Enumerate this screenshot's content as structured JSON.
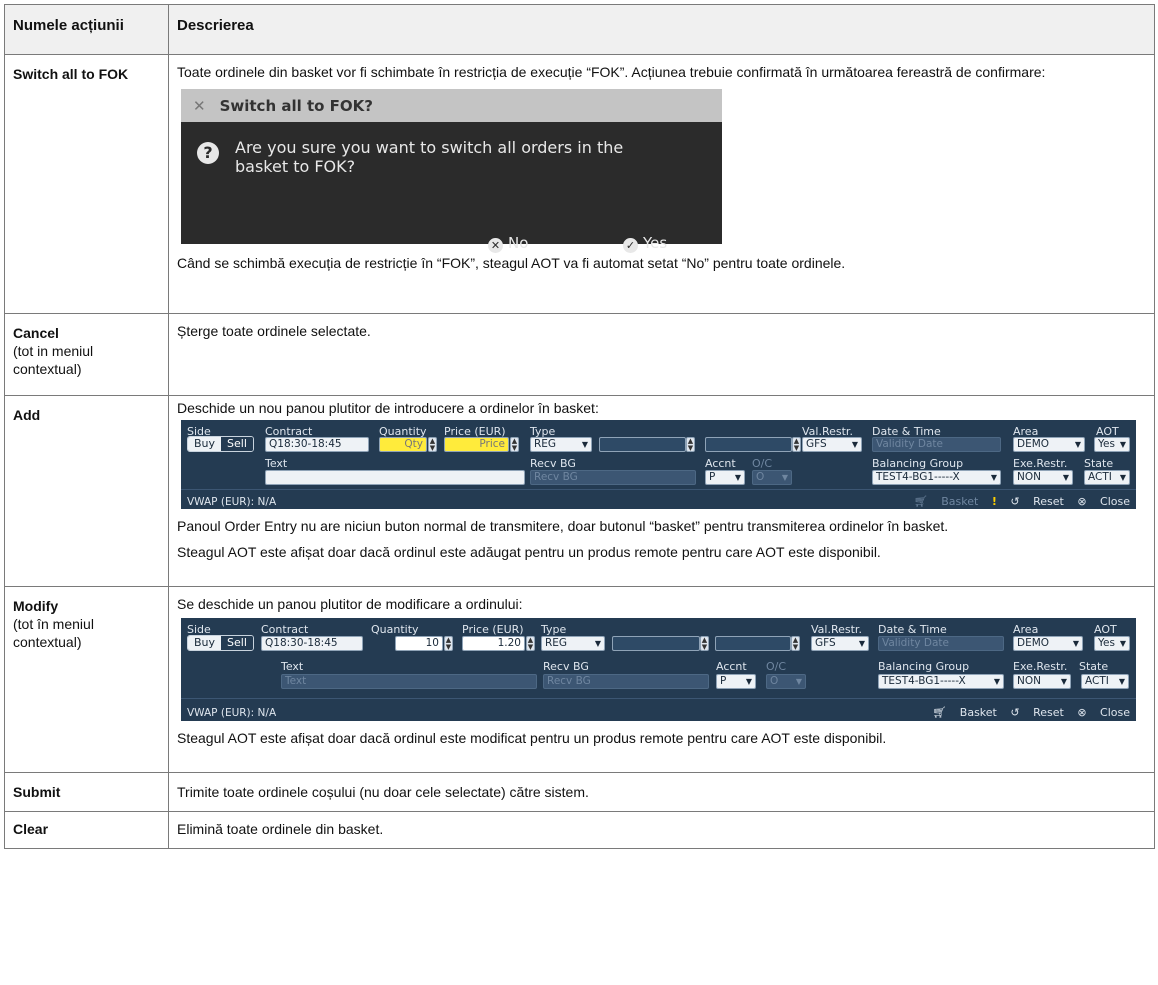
{
  "header": {
    "col1": "Numele acțiunii",
    "col2": "Descrierea"
  },
  "rows": {
    "switch": {
      "name": "Switch all to FOK",
      "desc1": "Toate ordinele din basket vor fi schimbate în restricția de execuție “FOK”. Acțiunea trebuie confirmată în următoarea fereastră de confirmare:",
      "desc2": "Când se schimbă execuția de restricție în  “FOK”, steagul AOT va fi  automat setat  “No” pentru toate ordinele.",
      "dialog": {
        "title": "Switch all to FOK?",
        "message": "Are you sure you want to switch all orders in the basket to FOK?",
        "no": "No",
        "yes": "Yes"
      }
    },
    "cancel": {
      "name": "Cancel",
      "sub": "(tot in meniul contextual)",
      "desc": "Șterge toate ordinele selectate."
    },
    "add": {
      "name": "Add",
      "desc1": "Deschide un nou panou plutitor de introducere a ordinelor în basket:",
      "desc2": "Panoul Order Entry nu are niciun buton normal de transmitere, doar butonul “basket” pentru transmiterea ordinelor în basket.",
      "desc3": "Steagul AOT este afișat doar dacă ordinul este adăugat pentru un produs remote pentru care AOT este disponibil."
    },
    "modify": {
      "name": "Modify",
      "sub": "(tot în meniul contextual)",
      "desc1": "Se deschide un panou plutitor de modificare a ordinului:",
      "desc2": "Steagul AOT este afișat doar dacă ordinul este modificat pentru un produs remote pentru care AOT este disponibil."
    },
    "submit": {
      "name": "Submit",
      "desc": "Trimite toate ordinele coșului (nu doar cele selectate) către sistem."
    },
    "clear": {
      "name": "Clear",
      "desc": "Elimină toate ordinele din basket."
    }
  },
  "panel_labels": {
    "side": "Side",
    "buy": "Buy",
    "sell": "Sell",
    "contract": "Contract",
    "quantity": "Quantity",
    "price": "Price (EUR)",
    "type": "Type",
    "valrestr": "Val.Restr.",
    "datetime": "Date & Time",
    "area": "Area",
    "aot": "AOT",
    "text": "Text",
    "recvbg": "Recv BG",
    "accnt": "Accnt",
    "oc": "O/C",
    "balgroup": "Balancing Group",
    "exerestr": "Exe.Restr.",
    "state": "State",
    "vwap": "VWAP (EUR):",
    "basket": "Basket",
    "reset": "Reset",
    "close": "Close"
  },
  "add_panel": {
    "contract": "Q18:30-18:45",
    "qty": "Qty",
    "price": "Price",
    "type": "REG",
    "valrestr": "GFS",
    "validity": "Validity Date",
    "area": "DEMO",
    "aot": "Yes",
    "recvbg_ph": "Recv BG",
    "accnt": "P",
    "oc": "O",
    "balgroup": "TEST4-BG1-----X",
    "exerestr": "NON",
    "state": "ACTI",
    "vwap": "N/A",
    "warn": "!"
  },
  "modify_panel": {
    "contract": "Q18:30-18:45",
    "qty": "10",
    "price": "1.20",
    "type": "REG",
    "valrestr": "GFS",
    "validity": "Validity Date",
    "area": "DEMO",
    "aot": "Yes",
    "text_ph": "Text",
    "recvbg_ph": "Recv BG",
    "accnt": "P",
    "oc": "O",
    "balgroup": "TEST4-BG1-----X",
    "exerestr": "NON",
    "state": "ACTI",
    "vwap": "N/A"
  },
  "colors": {
    "panel_bg": "#243b52",
    "dialog_bg": "#2b2b2b",
    "qty_highlight": "#ffeb3b"
  }
}
